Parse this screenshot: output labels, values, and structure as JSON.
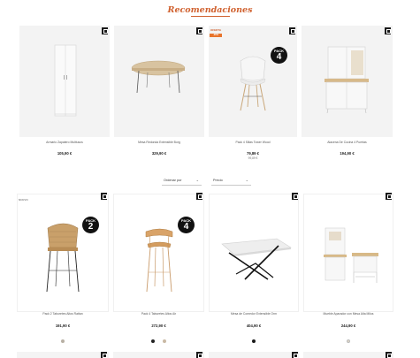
{
  "section_title": "Recomendaciones",
  "filters": {
    "order_label": "Ordenar por",
    "price_label": "Precio"
  },
  "icons": {
    "bookmark": "bookmark-icon",
    "chevron": "chevron-down-icon"
  },
  "colors": {
    "accent": "#d0612f",
    "offer_badge": "#e8742c"
  },
  "recommendations": [
    {
      "name": "Armario Zapatero Multiusos",
      "price": "105,90 €"
    },
    {
      "name": "Mesa Redonda Extensible Borg",
      "price": "329,90 €"
    },
    {
      "name": "Pack 4 Sillas Tower Wood",
      "price": "79,89 €",
      "sub": "99,89 €",
      "badge": "OFERTA",
      "badge_box": "-20%",
      "pack_label": "PACK",
      "pack_number": "4"
    },
    {
      "name": "Alacena De Cocina 4 Puertas",
      "price": "194,90 €"
    }
  ],
  "products": [
    {
      "name": "Pack 2 Taburetes Altos Rattan",
      "price": "191,90 €",
      "badge": "NUEVO",
      "pack_label": "PACK",
      "pack_number": "2",
      "swatches": [
        "#b8b0a4"
      ]
    },
    {
      "name": "Pack 4 Taburetes Altos Air",
      "price": "272,90 €",
      "pack_label": "PACK",
      "pack_number": "4",
      "swatches": [
        "#222222",
        "#c9b9a4"
      ]
    },
    {
      "name": "Mesa de Comedor Extensible Orm",
      "price": "404,90 €",
      "swatches": [
        "#1a1a1a"
      ]
    },
    {
      "name": "Mueble Aparador con Mesa Alta Milos",
      "price": "244,90 €",
      "swatches": [
        "#e2d9c9"
      ]
    }
  ]
}
